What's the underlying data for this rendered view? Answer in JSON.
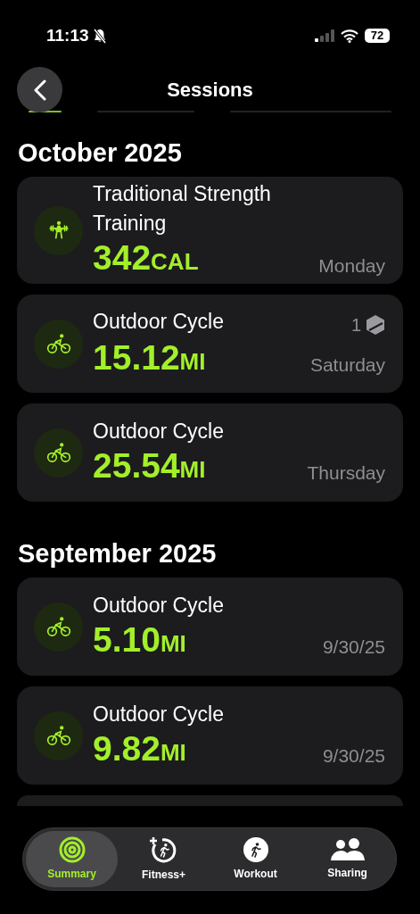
{
  "status_bar": {
    "time": "11:13",
    "battery": "72"
  },
  "nav": {
    "title": "Sessions"
  },
  "sections": [
    {
      "heading": "October 2025",
      "sessions": [
        {
          "kind": "strength",
          "title": "Traditional Strength Training",
          "value": "342",
          "unit": "CAL",
          "date": "Monday"
        },
        {
          "kind": "cycle",
          "title": "Outdoor Cycle",
          "value": "15.12",
          "unit": "MI",
          "date": "Saturday",
          "badge": "1"
        },
        {
          "kind": "cycle",
          "title": "Outdoor Cycle",
          "value": "25.54",
          "unit": "MI",
          "date": "Thursday"
        }
      ]
    },
    {
      "heading": "September 2025",
      "sessions": [
        {
          "kind": "cycle",
          "title": "Outdoor Cycle",
          "value": "5.10",
          "unit": "MI",
          "date": "9/30/25"
        },
        {
          "kind": "cycle",
          "title": "Outdoor Cycle",
          "value": "9.82",
          "unit": "MI",
          "date": "9/30/25"
        }
      ]
    }
  ],
  "tabs": [
    {
      "kind": "summary",
      "label": "Summary",
      "selected": true
    },
    {
      "kind": "fitness",
      "label": "Fitness+",
      "selected": false
    },
    {
      "kind": "workout",
      "label": "Workout",
      "selected": false
    },
    {
      "kind": "sharing",
      "label": "Sharing",
      "selected": false
    }
  ]
}
